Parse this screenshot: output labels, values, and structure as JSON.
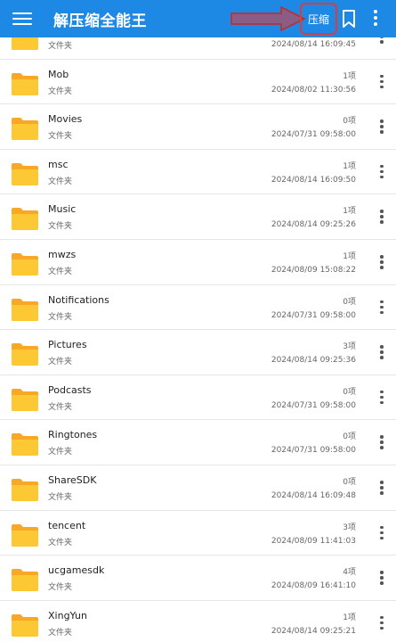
{
  "appbar": {
    "menu_icon": "hamburger-menu-icon",
    "title": "解压缩全能王",
    "compress_label": "压缩",
    "bookmark_icon": "bookmark-icon",
    "more_icon": "more-vertical-icon",
    "annotation_color": "#e53935",
    "bar_color": "#1e88e5"
  },
  "files": {
    "folder_icon": "folder-icon",
    "items": [
      {
        "name": "",
        "type": "文件夹",
        "count": "",
        "date": "2024/08/14 16:09:45"
      },
      {
        "name": "Mob",
        "type": "文件夹",
        "count": "1项",
        "date": "2024/08/02 11:30:56"
      },
      {
        "name": "Movies",
        "type": "文件夹",
        "count": "0项",
        "date": "2024/07/31 09:58:00"
      },
      {
        "name": "msc",
        "type": "文件夹",
        "count": "1项",
        "date": "2024/08/14 16:09:50"
      },
      {
        "name": "Music",
        "type": "文件夹",
        "count": "1项",
        "date": "2024/08/14 09:25:26"
      },
      {
        "name": "mwzs",
        "type": "文件夹",
        "count": "1项",
        "date": "2024/08/09 15:08:22"
      },
      {
        "name": "Notifications",
        "type": "文件夹",
        "count": "0项",
        "date": "2024/07/31 09:58:00"
      },
      {
        "name": "Pictures",
        "type": "文件夹",
        "count": "3项",
        "date": "2024/08/14 09:25:36"
      },
      {
        "name": "Podcasts",
        "type": "文件夹",
        "count": "0项",
        "date": "2024/07/31 09:58:00"
      },
      {
        "name": "Ringtones",
        "type": "文件夹",
        "count": "0项",
        "date": "2024/07/31 09:58:00"
      },
      {
        "name": "ShareSDK",
        "type": "文件夹",
        "count": "0项",
        "date": "2024/08/14 16:09:48"
      },
      {
        "name": "tencent",
        "type": "文件夹",
        "count": "3项",
        "date": "2024/08/09 11:41:03"
      },
      {
        "name": "ucgamesdk",
        "type": "文件夹",
        "count": "4项",
        "date": "2024/08/09 16:41:10"
      },
      {
        "name": "XingYun",
        "type": "文件夹",
        "count": "1项",
        "date": "2024/08/14 09:25:21"
      }
    ]
  }
}
